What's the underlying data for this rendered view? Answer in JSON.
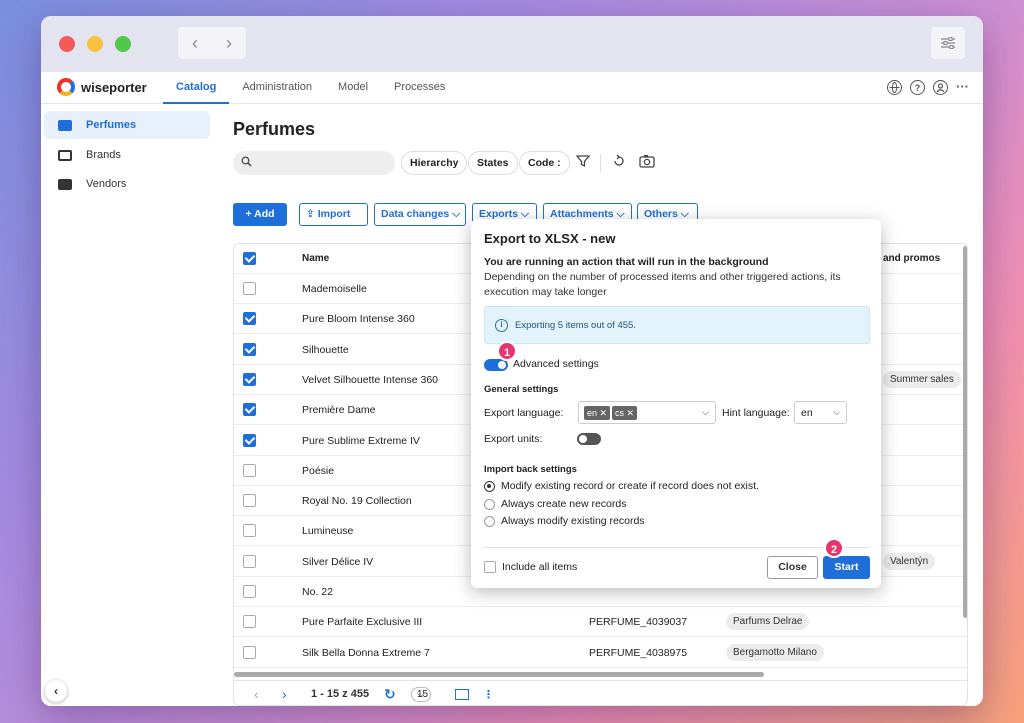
{
  "nav": {
    "back": "‹",
    "forward": "›"
  },
  "app": {
    "brand": "wiseporter",
    "tabs": [
      {
        "label": "Catalog"
      },
      {
        "label": "Administration"
      },
      {
        "label": "Model"
      },
      {
        "label": "Processes"
      }
    ],
    "help_icon_label": "?"
  },
  "sidebar": {
    "items": [
      {
        "label": "Perfumes",
        "icon": "folder-icon"
      },
      {
        "label": "Brands",
        "icon": "store-icon"
      },
      {
        "label": "Vendors",
        "icon": "truck-icon"
      }
    ]
  },
  "page": {
    "title": "Perfumes",
    "search": {
      "placeholder": ""
    },
    "filters": [
      "Hierarchy",
      "States",
      "Code"
    ],
    "code_suffix": ":",
    "actions": {
      "add": "+ Add",
      "import": "Import",
      "data_changes": "Data changes",
      "exports": "Exports",
      "attachments": "Attachments",
      "others": "Others"
    }
  },
  "table": {
    "columns": [
      "Name",
      "and promos"
    ],
    "rows": [
      {
        "name": "Mademoiselle",
        "checked": false,
        "code": "",
        "vendor": "",
        "promo": ""
      },
      {
        "name": "Pure Bloom Intense 360",
        "checked": true,
        "code": "",
        "vendor": "",
        "promo": ""
      },
      {
        "name": "Silhouette",
        "checked": true,
        "code": "",
        "vendor": "",
        "promo": ""
      },
      {
        "name": "Velvet Silhouette Intense 360",
        "checked": true,
        "code": "",
        "vendor": "",
        "promo": "Summer sales"
      },
      {
        "name": "Première Dame",
        "checked": true,
        "code": "",
        "vendor": "",
        "promo": ""
      },
      {
        "name": "Pure Sublime Extreme IV",
        "checked": true,
        "code": "",
        "vendor": "",
        "promo": ""
      },
      {
        "name": "Poésie",
        "checked": false,
        "code": "",
        "vendor": "",
        "promo": ""
      },
      {
        "name": "Royal No. 19 Collection",
        "checked": false,
        "code": "",
        "vendor": "",
        "promo": ""
      },
      {
        "name": "Lumineuse",
        "checked": false,
        "code": "",
        "vendor": "",
        "promo": ""
      },
      {
        "name": "Silver Délice IV",
        "checked": false,
        "code": "",
        "vendor": "",
        "promo": "Valentýn"
      },
      {
        "name": "No. 22",
        "checked": false,
        "code": "",
        "vendor": "",
        "promo": ""
      },
      {
        "name": "Pure Parfaite Exclusive III",
        "checked": false,
        "code": "PERFUME_4039037",
        "vendor": "Parfums Delrae",
        "promo": ""
      },
      {
        "name": "Silk Bella Donna Extreme 7",
        "checked": false,
        "code": "PERFUME_4038975",
        "vendor": "Bergamotto Milano",
        "promo": ""
      }
    ],
    "pager": {
      "range": "1 - 15 z 455",
      "page_size": "15"
    }
  },
  "dialog": {
    "title": "Export to XLSX - new",
    "warning": "You are running an action that will run in the background",
    "description": "Depending on the number of processed items and other triggered actions, its execution may take longer",
    "info": "Exporting 5 items out of 455.",
    "advanced_label": "Advanced settings",
    "advanced_on": true,
    "general_heading": "General settings",
    "export_language_label": "Export language:",
    "export_languages": [
      "en",
      "cs"
    ],
    "hint_language_label": "Hint language:",
    "hint_language": "en",
    "export_units_label": "Export units:",
    "export_units_on": false,
    "import_back_heading": "Import back settings",
    "radio_options": [
      {
        "label": "Modify existing record or create if record does not exist.",
        "selected": true
      },
      {
        "label": "Always create new records",
        "selected": false
      },
      {
        "label": "Always modify existing records",
        "selected": false
      }
    ],
    "include_all_label": "Include all items",
    "close_label": "Close",
    "start_label": "Start"
  },
  "badges": [
    "1",
    "2"
  ],
  "colors": {
    "accent": "#1e6fd9",
    "badge": "#e8336e"
  }
}
